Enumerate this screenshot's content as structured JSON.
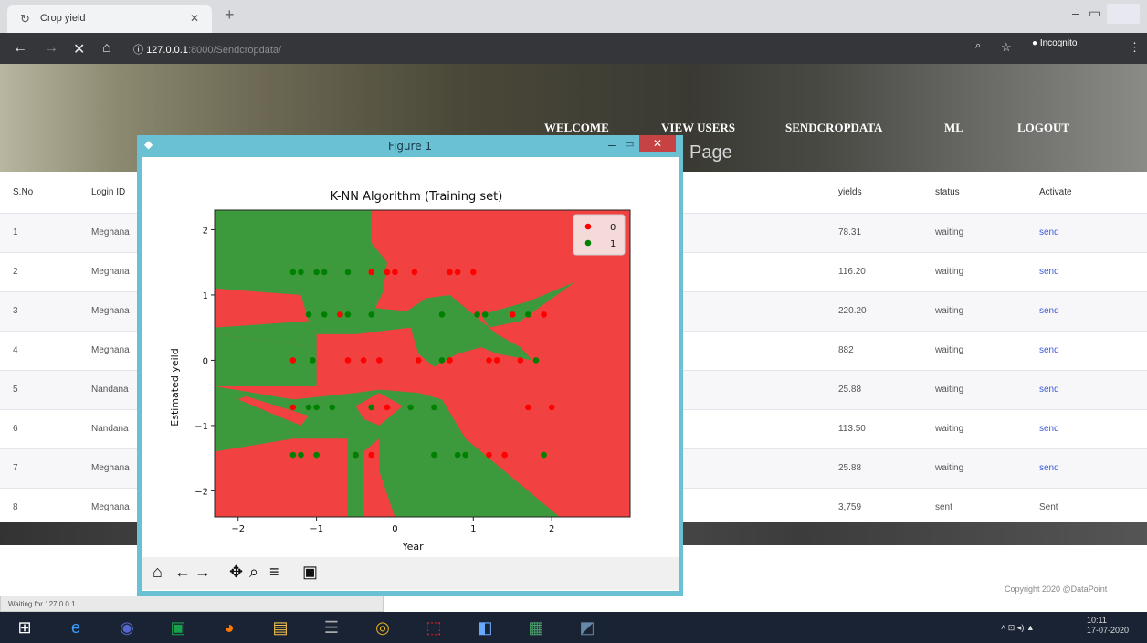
{
  "browser": {
    "tab_title": "Crop yield",
    "tab_icon": "circle-arrow-icon",
    "new_tab": "+",
    "url_host": "127.0.0.1",
    "url_rest": ":8000/Sendcropdata/",
    "incognito_label": "Incognito"
  },
  "nav": {
    "welcome": "WELCOME",
    "view_users": "VIEW USERS",
    "sendcropdata": "SENDCROPDATA",
    "ml": "ML",
    "logout": "LOGOUT",
    "page_title": "Page"
  },
  "table": {
    "headers": {
      "sno": "S.No",
      "login": "Login ID",
      "yields": "yields",
      "status": "status",
      "activate": "Activate"
    },
    "rows": [
      {
        "sno": "1",
        "login": "Meghana",
        "yields": "78.31",
        "status": "waiting",
        "activate": "send"
      },
      {
        "sno": "2",
        "login": "Meghana",
        "yields": "116.20",
        "status": "waiting",
        "activate": "send"
      },
      {
        "sno": "3",
        "login": "Meghana",
        "yields": "220.20",
        "status": "waiting",
        "activate": "send"
      },
      {
        "sno": "4",
        "login": "Meghana",
        "yields": "882",
        "status": "waiting",
        "activate": "send"
      },
      {
        "sno": "5",
        "login": "Nandana",
        "yields": "25.88",
        "status": "waiting",
        "activate": "send"
      },
      {
        "sno": "6",
        "login": "Nandana",
        "yields": "113.50",
        "status": "waiting",
        "activate": "send"
      },
      {
        "sno": "7",
        "login": "Meghana",
        "yields": "25.88",
        "status": "waiting",
        "activate": "send"
      },
      {
        "sno": "8",
        "login": "Meghana",
        "yields": "3,759",
        "status": "sent",
        "activate": "Sent"
      }
    ]
  },
  "copyright": "Copyright 2020 @DataPoint",
  "status_text": "Waiting for 127.0.0.1...",
  "figure": {
    "window_title": "Figure 1",
    "close": "✕"
  },
  "chart_data": {
    "type": "scatter",
    "title": "K-NN Algorithm (Training set)",
    "xlabel": "Year",
    "ylabel": "Estimated yeild",
    "xlim": [
      -2.3,
      3.0
    ],
    "ylim": [
      -2.4,
      2.3
    ],
    "xticks": [
      "-2",
      "-1",
      "0",
      "1",
      "2"
    ],
    "yticks": [
      "2",
      "1",
      "0",
      "-1",
      "-2"
    ],
    "legend": "top-right",
    "background": "decision regions",
    "colors": {
      "0": "#ff0000",
      "1": "#008000",
      "region0": "#f24141",
      "region1": "#3c9a3c"
    },
    "series": [
      {
        "name": "0",
        "points": [
          [
            -0.3,
            1.35
          ],
          [
            -0.1,
            1.35
          ],
          [
            0.0,
            1.35
          ],
          [
            0.25,
            1.35
          ],
          [
            0.7,
            1.35
          ],
          [
            0.8,
            1.35
          ],
          [
            1.0,
            1.35
          ],
          [
            -0.7,
            0.7
          ],
          [
            1.5,
            0.7
          ],
          [
            1.9,
            0.7
          ],
          [
            -1.3,
            0.0
          ],
          [
            -0.6,
            0.0
          ],
          [
            -0.4,
            0.0
          ],
          [
            -0.2,
            0.0
          ],
          [
            0.3,
            0.0
          ],
          [
            0.7,
            0.0
          ],
          [
            1.2,
            0.0
          ],
          [
            1.3,
            0.0
          ],
          [
            1.6,
            0.0
          ],
          [
            -1.3,
            -0.72
          ],
          [
            -0.1,
            -0.72
          ],
          [
            1.7,
            -0.72
          ],
          [
            2.0,
            -0.72
          ],
          [
            -0.5,
            -1.45
          ],
          [
            -0.3,
            -1.45
          ],
          [
            1.2,
            -1.45
          ],
          [
            1.4,
            -1.45
          ]
        ]
      },
      {
        "name": "1",
        "points": [
          [
            -1.3,
            1.35
          ],
          [
            -1.2,
            1.35
          ],
          [
            -1.0,
            1.35
          ],
          [
            -0.9,
            1.35
          ],
          [
            -0.6,
            1.35
          ],
          [
            -1.1,
            0.7
          ],
          [
            -0.9,
            0.7
          ],
          [
            -0.6,
            0.7
          ],
          [
            -0.3,
            0.7
          ],
          [
            0.6,
            0.7
          ],
          [
            1.05,
            0.7
          ],
          [
            1.15,
            0.7
          ],
          [
            1.7,
            0.7
          ],
          [
            -1.05,
            0.0
          ],
          [
            0.6,
            0.0
          ],
          [
            1.8,
            0.0
          ],
          [
            -1.1,
            -0.72
          ],
          [
            -1.0,
            -0.72
          ],
          [
            -0.8,
            -0.72
          ],
          [
            -0.3,
            -0.72
          ],
          [
            0.2,
            -0.72
          ],
          [
            0.5,
            -0.72
          ],
          [
            -1.3,
            -1.45
          ],
          [
            -1.2,
            -1.45
          ],
          [
            -1.0,
            -1.45
          ],
          [
            -0.5,
            -1.45
          ],
          [
            0.5,
            -1.45
          ],
          [
            0.8,
            -1.45
          ],
          [
            0.9,
            -1.45
          ],
          [
            1.9,
            -1.45
          ]
        ]
      }
    ]
  },
  "taskbar_icons": [
    "windows-start-icon",
    "edge-icon",
    "media-icon",
    "store-icon",
    "firefox-icon",
    "explorer-icon",
    "database-icon",
    "chrome-icon",
    "pdf-icon",
    "app-icon",
    "photo-icon",
    "python-icon"
  ],
  "tray": {
    "time": "10:11",
    "date": "17-07-2020"
  }
}
